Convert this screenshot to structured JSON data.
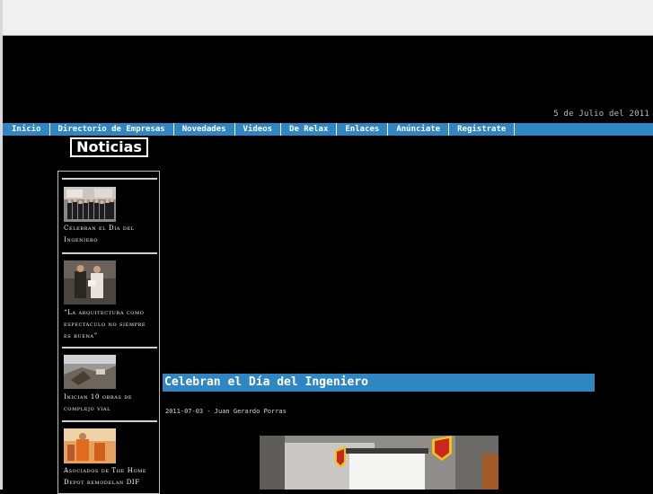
{
  "header": {
    "date": "5 de Julio del 2011"
  },
  "nav": {
    "items": [
      {
        "label": "Inicio"
      },
      {
        "label": "Directorio de Empresas"
      },
      {
        "label": "Novedades"
      },
      {
        "label": "Videos"
      },
      {
        "label": "De Relax"
      },
      {
        "label": "Enlaces"
      },
      {
        "label": "Anúnciate"
      },
      {
        "label": "Registrate"
      }
    ]
  },
  "sidebar": {
    "title": "Noticias",
    "items": [
      {
        "title": "Celebran el Día del Ingeniero"
      },
      {
        "title": "“La arquitectura como espectáculo no siempre es buena”"
      },
      {
        "title": "Inician 10 obras de complejo vial"
      },
      {
        "title": "Asociados de The Home Depot remodelan DIF"
      }
    ]
  },
  "article": {
    "title": "Celebran el Día del Ingeniero",
    "byline": "2011-07-03 - Juan Gerardo Porras"
  },
  "colors": {
    "accent": "#2f86c3",
    "background": "#000000"
  }
}
